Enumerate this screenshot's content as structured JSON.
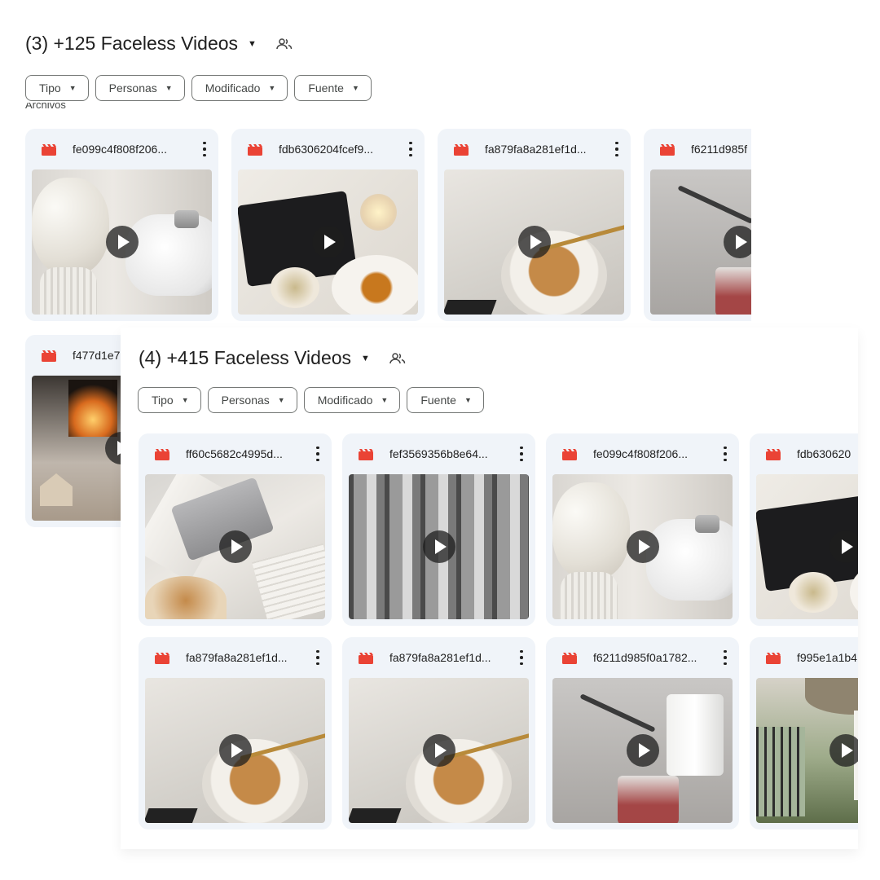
{
  "colors": {
    "video_icon": "#ea4335",
    "card_bg": "#f0f4f9",
    "chip_border": "#747775",
    "text": "#1f1f1f"
  },
  "back_folder": {
    "title": "(3) +125 Faceless Videos",
    "section_label": "Archivos",
    "filters": [
      "Tipo",
      "Personas",
      "Modificado",
      "Fuente"
    ],
    "files": [
      "fe099c4f808f206...",
      "fdb6306204fcef9...",
      "fa879fa8a281ef1d...",
      "f6211d985f",
      "f477d1e7"
    ]
  },
  "front_folder": {
    "title": "(4) +415 Faceless Videos",
    "filters": [
      "Tipo",
      "Personas",
      "Modificado",
      "Fuente"
    ],
    "files": [
      "ff60c5682c4995d...",
      "fef3569356b8e64...",
      "fe099c4f808f206...",
      "fdb630620",
      "fa879fa8a281ef1d...",
      "fa879fa8a281ef1d...",
      "f6211d985f0a1782...",
      "f995e1a1b4"
    ]
  },
  "icons": {
    "shared": "people-icon",
    "file_type": "video-file-icon",
    "menu": "more-vert-icon",
    "dropdown": "arrow-drop-down-icon",
    "play": "play-icon"
  }
}
